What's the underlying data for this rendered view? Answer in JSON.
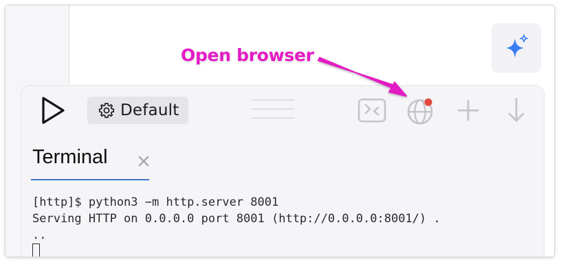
{
  "annotation": {
    "text": "Open browser",
    "color": "#e31bc4"
  },
  "top_right_button": {
    "icon": "sparkle-icon",
    "accent": "#3b7cf4"
  },
  "toolbar": {
    "run_icon": "play-icon",
    "config_icon": "gear-icon",
    "config_label": "Default",
    "drag_handle": "drag-handle",
    "tools": [
      {
        "name": "terminal-toggle-icon"
      },
      {
        "name": "globe-icon",
        "badge_color": "#e5483b"
      },
      {
        "name": "plus-icon"
      },
      {
        "name": "arrow-down-icon"
      }
    ]
  },
  "tabs": [
    {
      "label": "Terminal",
      "active": true,
      "close_icon": "close-icon"
    }
  ],
  "terminal": {
    "lines": [
      "[http]$ python3 −m http.server 8001",
      "Serving HTTP on 0.0.0.0 port 8001 (http://0.0.0.0:8001/) .",
      ".."
    ]
  }
}
